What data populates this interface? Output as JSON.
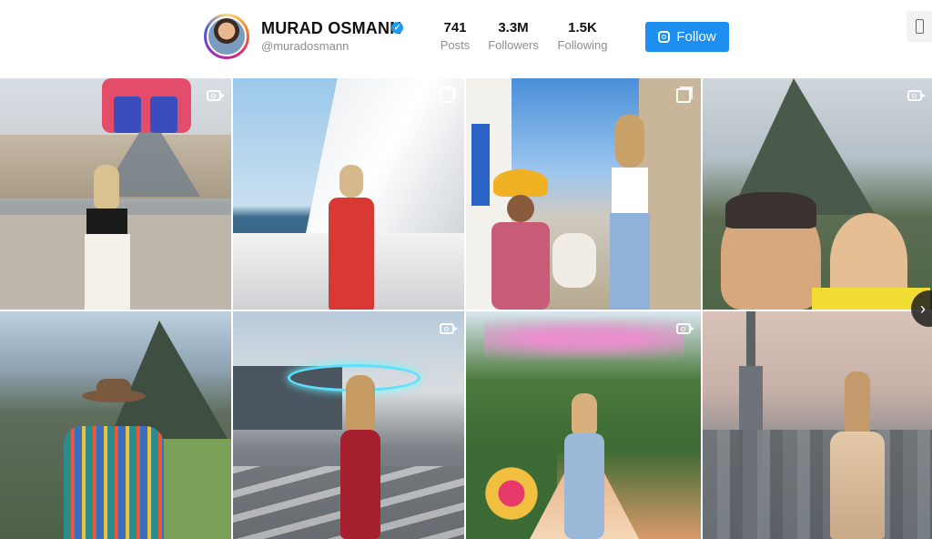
{
  "profile": {
    "name": "MURAD OSMANN",
    "handle": "@muradosmann",
    "verified_mark": "✓"
  },
  "stats": [
    {
      "value": "741",
      "label": "Posts"
    },
    {
      "value": "3.3M",
      "label": "Followers"
    },
    {
      "value": "1.5K",
      "label": "Following"
    }
  ],
  "follow_label": "Follow",
  "icons": {
    "follow": "instagram-icon",
    "phone": "phone-icon",
    "next": "chevron-right-icon",
    "next_glyph": "›"
  },
  "tiles": [
    {
      "scene": "Louvre pyramid, Paris",
      "badge": "video"
    },
    {
      "scene": "Sailboat at sea",
      "badge": "carousel"
    },
    {
      "scene": "Cusco street with llama",
      "badge": "carousel"
    },
    {
      "scene": "Machu Picchu selfie",
      "badge": "video"
    },
    {
      "scene": "Machu Picchu woman in poncho",
      "badge": "none"
    },
    {
      "scene": "City Walk at dusk",
      "badge": "video"
    },
    {
      "scene": "Flower garden walkway",
      "badge": "video"
    },
    {
      "scene": "Dubai skyline",
      "badge": "none"
    }
  ],
  "colors": {
    "follow_button": "#1d8ff0",
    "verified": "#1f9bf0",
    "muted_text": "#8e8e8e"
  }
}
